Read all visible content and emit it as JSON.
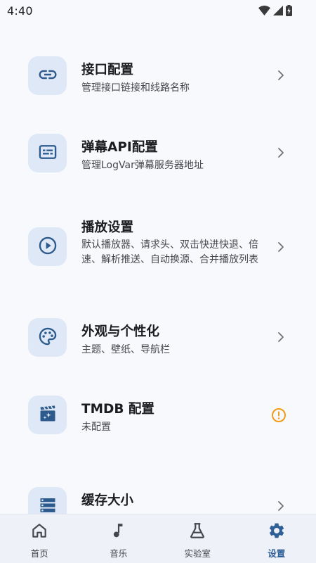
{
  "status_bar": {
    "time": "4:40",
    "icons": [
      "wifi-icon",
      "cellular-signal-icon",
      "battery-charging-icon"
    ]
  },
  "settings": {
    "items": [
      {
        "icon": "link-icon",
        "title": "接口配置",
        "description": "管理接口链接和线路名称",
        "trailing": "chevron-right-icon"
      },
      {
        "icon": "subtitles-icon",
        "title": "弹幕API配置",
        "description": "管理LogVar弹幕服务器地址",
        "trailing": "chevron-right-icon"
      },
      {
        "icon": "play-circle-icon",
        "title": "播放设置",
        "description": "默认播放器、请求头、双击快进快退、倍速、解析推送、自动换源、合并播放列表",
        "trailing": "chevron-right-icon"
      },
      {
        "icon": "palette-icon",
        "title": "外观与个性化",
        "description": "主题、壁纸、导航栏",
        "trailing": "chevron-right-icon"
      },
      {
        "icon": "movie-clapperboard-icon",
        "title": "TMDB 配置",
        "description": "未配置",
        "trailing": "warning-circle-icon"
      },
      {
        "icon": "storage-icon",
        "title": "缓存大小",
        "description": "",
        "trailing": "chevron-right-icon"
      }
    ]
  },
  "bottom_nav": {
    "items": [
      {
        "label": "首页",
        "icon": "home-icon",
        "active": false
      },
      {
        "label": "音乐",
        "icon": "music-note-icon",
        "active": false
      },
      {
        "label": "实验室",
        "icon": "flask-icon",
        "active": false
      },
      {
        "label": "设置",
        "icon": "gear-icon",
        "active": true
      }
    ]
  },
  "colors": {
    "background": "#f8f9fd",
    "icon_tile": "#dfe8f6",
    "icon": "#2c5a8c",
    "accent": "#2e5f96",
    "warning": "#f29b16",
    "chevron": "#6f7278",
    "nav_background": "#eef1f7"
  }
}
